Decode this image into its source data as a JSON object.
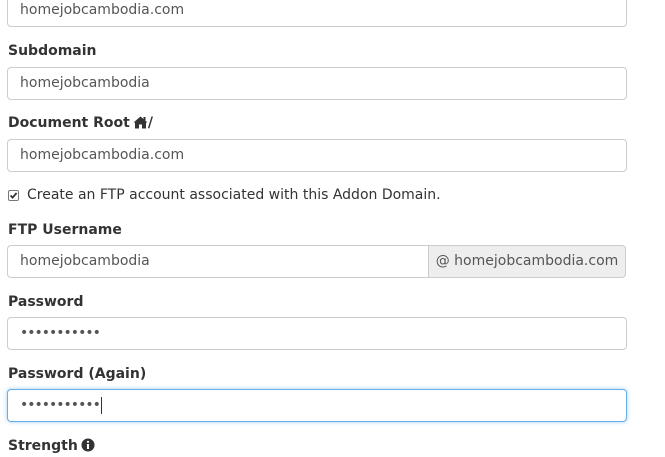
{
  "fields": {
    "domain_value": "homejobcambodia.com",
    "subdomain_label": "Subdomain",
    "subdomain_value": "homejobcambodia",
    "docroot_label": "Document Root",
    "docroot_slash": "/",
    "docroot_value": "homejobcambodia.com",
    "ftp_checkbox_label": "Create an FTP account associated with this Addon Domain.",
    "ftp_checkbox_checked": true,
    "ftp_username_label": "FTP Username",
    "ftp_username_value": "homejobcambodia",
    "ftp_username_suffix": "@ homejobcambodia.com",
    "password_label": "Password",
    "password_value": "•••••••••••",
    "password_again_label": "Password (Again)",
    "password_again_value": "•••••••••••",
    "strength_label": "Strength"
  },
  "icons": {
    "home": "home-icon",
    "info": "info-circle-icon",
    "check": "check-icon"
  },
  "colors": {
    "text": "#333333",
    "input_text": "#555555",
    "border": "#cccccc",
    "focus_border": "#66afe9",
    "addon_bg": "#eeeeee"
  }
}
